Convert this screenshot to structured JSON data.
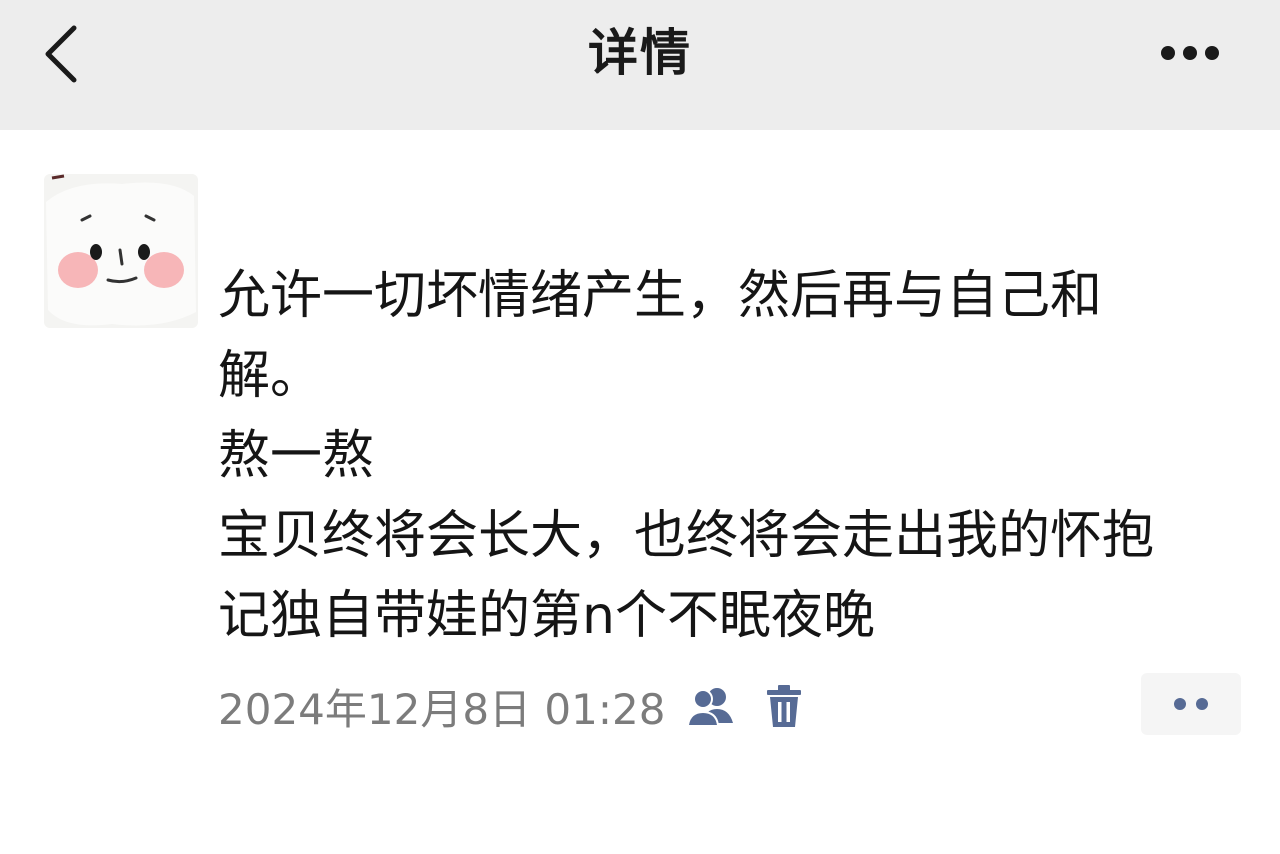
{
  "header": {
    "title": "详情",
    "back_icon": "chevron-left-icon",
    "more_icon": "more-dots-icon"
  },
  "post": {
    "lines": [
      "允许一切坏情绪产生，然后再与自己和",
      "解。",
      "熬一熬",
      "宝贝终将会长大，也终将会走出我的怀抱",
      "记独自带娃的第n个不眠夜晚"
    ],
    "timestamp": "2024年12月8日 01:28",
    "privacy_icon": "visible-to-friends-icon",
    "delete_icon": "trash-icon",
    "comment_icon": "comment-dots-icon"
  },
  "colors": {
    "header_bg": "#ededed",
    "page_bg": "#ffffff",
    "text": "#151515",
    "meta_text": "#7c7c7c",
    "link_blue": "#576b95"
  }
}
